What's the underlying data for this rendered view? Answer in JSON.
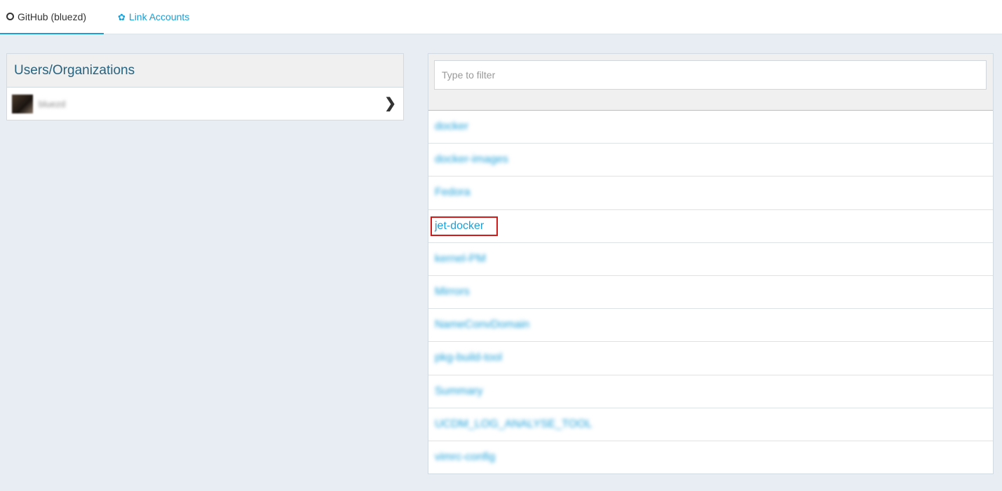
{
  "tabs": {
    "github_label": "GitHub (bluezd)",
    "link_label": "Link Accounts"
  },
  "users_panel": {
    "title": "Users/Organizations",
    "user_name": "bluezd"
  },
  "repos_panel": {
    "filter_placeholder": "Type to filter",
    "repos": [
      {
        "name": "docker",
        "blurred": true
      },
      {
        "name": "docker-images",
        "blurred": true
      },
      {
        "name": "Fedora",
        "blurred": true
      },
      {
        "name": "jet-docker",
        "blurred": false,
        "highlighted": true
      },
      {
        "name": "kernel-PM",
        "blurred": true
      },
      {
        "name": "Mirrors",
        "blurred": true
      },
      {
        "name": "NameConvDomain",
        "blurred": true
      },
      {
        "name": "pkg-build-tool",
        "blurred": true
      },
      {
        "name": "Summary",
        "blurred": true
      },
      {
        "name": "UCDM_LOG_ANALYSE_TOOL",
        "blurred": true
      },
      {
        "name": "vimrc-config",
        "blurred": true
      }
    ]
  },
  "colors": {
    "accent": "#1a9fd8",
    "highlight_border": "#d11a1a"
  }
}
